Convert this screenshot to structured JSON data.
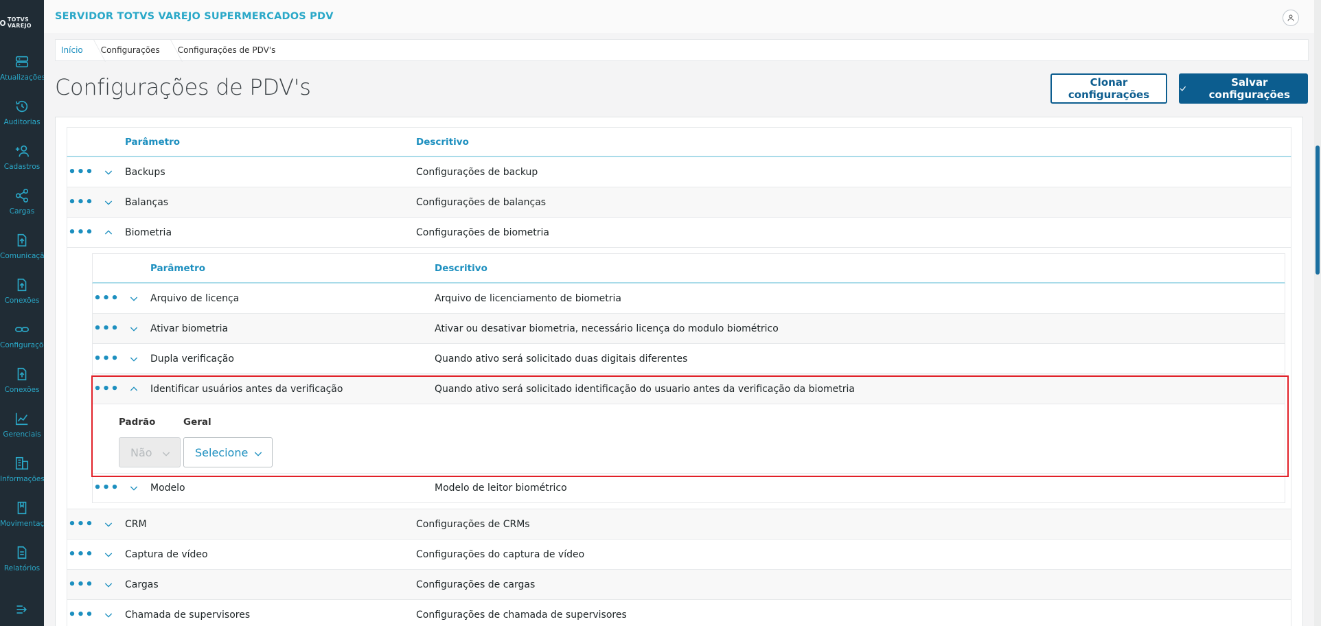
{
  "app": {
    "title": "SERVIDOR TOTVS VAREJO SUPERMERCADOS PDV",
    "logo_text": "TOTVS VAREJO"
  },
  "sidebar": {
    "items": [
      {
        "label": "Atualizações",
        "icon": "server-icon"
      },
      {
        "label": "Auditorias",
        "icon": "history-icon"
      },
      {
        "label": "Cadastros",
        "icon": "add-user-icon"
      },
      {
        "label": "Cargas",
        "icon": "share-icon"
      },
      {
        "label": "Comunicação",
        "icon": "upload-file-icon"
      },
      {
        "label": "Conexões",
        "icon": "upload-file-icon"
      },
      {
        "label": "Configurações",
        "icon": "link-icon"
      },
      {
        "label": "Conexões",
        "icon": "upload-file-icon"
      },
      {
        "label": "Gerenciais",
        "icon": "chart-icon"
      },
      {
        "label": "Informações",
        "icon": "building-icon"
      },
      {
        "label": "Movimentações",
        "icon": "book-icon"
      },
      {
        "label": "Relatórios",
        "icon": "document-icon"
      }
    ]
  },
  "breadcrumb": [
    "Início",
    "Configurações",
    "Configurações de PDV's"
  ],
  "page": {
    "title": "Configurações de PDV's",
    "clone_label": "Clonar configurações",
    "save_label": "Salvar configurações"
  },
  "table": {
    "headers": {
      "param": "Parâmetro",
      "desc": "Descritivo"
    },
    "rows_top": [
      {
        "param": "Backups",
        "desc": "Configurações de backup"
      },
      {
        "param": "Balanças",
        "desc": "Configurações de balanças"
      },
      {
        "param": "Biometria",
        "desc": "Configurações de biometria"
      }
    ],
    "nested": {
      "headers": {
        "param": "Parâmetro",
        "desc": "Descritivo"
      },
      "rows": [
        {
          "param": "Arquivo de licença",
          "desc": "Arquivo de licenciamento de biometria"
        },
        {
          "param": "Ativar biometria",
          "desc": "Ativar ou desativar biometria, necessário licença do modulo biométrico"
        },
        {
          "param": "Dupla verificação",
          "desc": "Quando ativo será solicitado duas digitais diferentes"
        },
        {
          "param": "Identificar usuários antes da verificação",
          "desc": "Quando ativo será solicitado identificação do usuario antes da verificação da biometria"
        }
      ],
      "detail": {
        "default_label": "Padrão",
        "general_label": "Geral",
        "default_value": "Não",
        "general_value": "Selecione"
      },
      "rows_after": [
        {
          "param": "Modelo",
          "desc": "Modelo de leitor biométrico"
        }
      ]
    },
    "rows_bottom": [
      {
        "param": "CRM",
        "desc": "Configurações de CRMs"
      },
      {
        "param": "Captura de vídeo",
        "desc": "Configurações do captura de vídeo"
      },
      {
        "param": "Cargas",
        "desc": "Configurações de cargas"
      },
      {
        "param": "Chamada de supervisores",
        "desc": "Configurações de chamada de supervisores"
      }
    ]
  }
}
